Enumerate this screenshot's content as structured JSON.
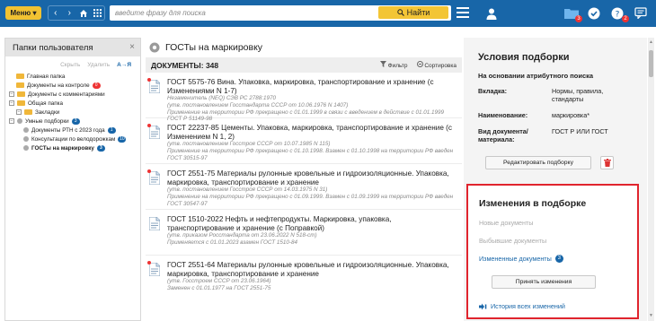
{
  "topbar": {
    "menu_label": "Меню ▾",
    "search_placeholder": "введите фразу для поиска",
    "find_label": "Найти",
    "badges": [
      "3",
      "2"
    ]
  },
  "sidebar": {
    "title": "Папки пользователя",
    "tools": {
      "hide": "Скрыть",
      "delete": "Удалить",
      "sort": "А→Я"
    },
    "tree": [
      {
        "label": "Главная папка",
        "kind": "folder",
        "indent": 1
      },
      {
        "label": "Документы на контроле",
        "kind": "folder",
        "indent": 1,
        "count": "0",
        "count_red": true
      },
      {
        "label": "Документы с комментариями",
        "kind": "folder-toggle",
        "indent": 0
      },
      {
        "label": "Общая папка",
        "kind": "folder-toggle",
        "indent": 0
      },
      {
        "label": "Закладки",
        "kind": "folder-toggle",
        "indent": 1
      },
      {
        "label": "Умные подборки",
        "kind": "smart-toggle",
        "indent": 0,
        "count": "3"
      },
      {
        "label": "Документы РТН с 2023 года",
        "kind": "smart",
        "indent": 2,
        "count": "1"
      },
      {
        "label": "Консультации по велодорожкам",
        "kind": "smart",
        "indent": 2,
        "count": "10"
      },
      {
        "label": "ГОСТы на маркировку",
        "kind": "smart",
        "indent": 2,
        "count": "3",
        "bold": true
      }
    ]
  },
  "main": {
    "title": "ГОСТы на маркировку",
    "docs_label": "ДОКУМЕНТЫ: 348",
    "filter_label": "Фильтр",
    "sort_label": "Сортировка",
    "docs": [
      {
        "title": "ГОСТ 5575-76 Вина. Упаковка, маркировка, транспортирование и хранение (с Изменениями N 1-7)",
        "meta": [
          "Незаменитель (NEQ) СЭВ РС 2788:1970",
          "(утв. постановлением Госстандарта СССР от 10.06.1976 N 1407)",
          "Применение на территории РФ прекращено с 01.01.1999 в связи с введением в действие с 01.01.1999 ГОСТ Р 51149-98"
        ],
        "new": true
      },
      {
        "title": "ГОСТ 22237-85 Цементы. Упаковка, маркировка, транспортирование и хранение (с Изменением N 1, 2)",
        "meta": [
          "(утв. постановлением Госстроя СССР от 10.07.1985 N 115)",
          "Применение на территории РФ прекращено с 01.10.1998. Взамен с 01.10.1998 на территории РФ введен ГОСТ 30515-97"
        ],
        "new": true
      },
      {
        "title": "ГОСТ 2551-75 Материалы рулонные кровельные и гидроизоляционные. Упаковка, маркировка, транспортирование и хранение",
        "meta": [
          "(утв. постановлением Госстроя СССР от 14.03.1975 N 31)",
          "Применение на территории РФ прекращено с 01.09.1999. Взамен с 01.09.1999 на территории РФ введен ГОСТ 30547-97"
        ],
        "new": true
      },
      {
        "title": "ГОСТ 1510-2022 Нефть и нефтепродукты. Маркировка, упаковка, транспортирование и хранение (с Поправкой)",
        "meta": [
          "(утв. приказом Росстандарта от 23.06.2022 N 518-ст)",
          "Применяется с 01.01.2023 взамен ГОСТ 1510-84"
        ],
        "new": false
      },
      {
        "title": "ГОСТ 2551-64 Материалы рулонные кровельные и гидроизоляционные. Упаковка, маркировка, транспортирование и хранение",
        "meta": [
          "(утв. Госстроем СССР от 23.06.1964)",
          "Заменен с 01.01.1977 на ГОСТ 2551-75"
        ],
        "new": true
      }
    ]
  },
  "conditions": {
    "title": "Условия подборки",
    "subtitle": "На основании атрибутного поиска",
    "rows": [
      {
        "key": "Вкладка:",
        "value": "Нормы, правила, стандарты"
      },
      {
        "key": "Наименование:",
        "value": "маркировка*"
      },
      {
        "key": "Вид документа/ материала:",
        "value": "ГОСТ Р ИЛИ ГОСТ"
      }
    ],
    "edit_label": "Редактировать подборку"
  },
  "changes": {
    "title": "Изменения в подборке",
    "new_docs": "Новые документы",
    "removed_docs": "Выбывшие документы",
    "changed_docs": "Измененные документы",
    "changed_count": "3",
    "apply_label": "Принять изменения",
    "history_label": "История всех изменений"
  },
  "colors": {
    "brand": "#1866a8",
    "accent": "#f3c535",
    "highlight": "#e0242d"
  }
}
